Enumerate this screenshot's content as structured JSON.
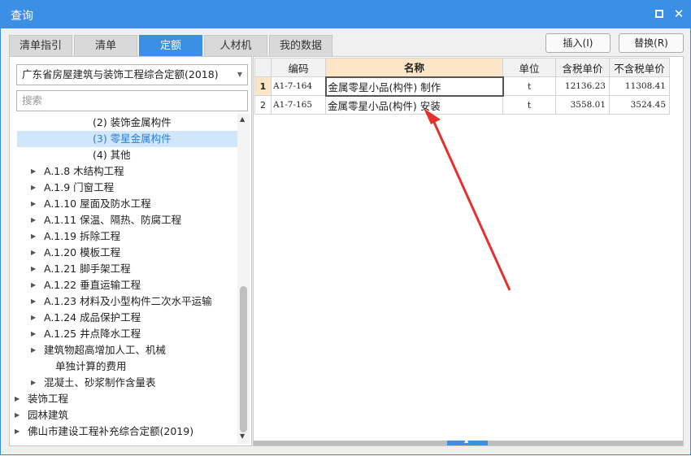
{
  "window": {
    "title": "查询",
    "maximize_icon": "maximize-icon",
    "close_icon": "close-icon",
    "close_glyph": "✕"
  },
  "tabs": [
    {
      "label": "清单指引"
    },
    {
      "label": "清单"
    },
    {
      "label": "定额",
      "active": true
    },
    {
      "label": "人材机"
    },
    {
      "label": "我的数据"
    }
  ],
  "actions": {
    "insert": "插入(I)",
    "replace": "替换(R)"
  },
  "left": {
    "selected_library": "广东省房屋建筑与装饰工程综合定额(2018)",
    "search_placeholder": "搜索",
    "tree": [
      {
        "label": "(2) 装饰金属构件",
        "arrow": ""
      },
      {
        "label": "(3) 零星金属构件",
        "arrow": "",
        "selected": true
      },
      {
        "label": "(4) 其他",
        "arrow": ""
      },
      {
        "label": "A.1.8 木结构工程",
        "arrow": "▶"
      },
      {
        "label": "A.1.9 门窗工程",
        "arrow": "▶"
      },
      {
        "label": "A.1.10 屋面及防水工程",
        "arrow": "▶"
      },
      {
        "label": "A.1.11 保温、隔热、防腐工程",
        "arrow": "▶"
      },
      {
        "label": "A.1.19 拆除工程",
        "arrow": "▶"
      },
      {
        "label": "A.1.20 模板工程",
        "arrow": "▶"
      },
      {
        "label": "A.1.21 脚手架工程",
        "arrow": "▶"
      },
      {
        "label": "A.1.22 垂直运输工程",
        "arrow": "▶"
      },
      {
        "label": "A.1.23 材料及小型构件二次水平运输",
        "arrow": "▶"
      },
      {
        "label": "A.1.24 成品保护工程",
        "arrow": "▶"
      },
      {
        "label": "A.1.25 井点降水工程",
        "arrow": "▶"
      },
      {
        "label": "建筑物超高增加人工、机械",
        "arrow": "▶"
      },
      {
        "label": "单独计算的费用",
        "arrow": ""
      },
      {
        "label": "混凝土、砂浆制作含量表",
        "arrow": "▶"
      },
      {
        "label": "装饰工程",
        "arrow": "▶"
      },
      {
        "label": "园林建筑",
        "arrow": "▶"
      },
      {
        "label": "佛山市建设工程补充综合定额(2019)",
        "arrow": "▶"
      }
    ],
    "scroll_up": "▲",
    "scroll_down": "▼"
  },
  "grid": {
    "headers": {
      "code": "编码",
      "name": "名称",
      "unit": "单位",
      "price_tax": "含税单价",
      "price_notax": "不含税单价"
    },
    "rows": [
      {
        "num": "1",
        "code": "A1-7-164",
        "name": "金属零星小品(构件) 制作",
        "unit": "t",
        "price_tax": "12136.23",
        "price_notax": "11308.41"
      },
      {
        "num": "2",
        "code": "A1-7-165",
        "name": "金属零星小品(构件) 安装",
        "unit": "t",
        "price_tax": "3558.01",
        "price_notax": "3524.45"
      }
    ]
  },
  "colors": {
    "accent": "#3b8fe5",
    "highlight": "#fde6c8",
    "annotation_arrow": "#e8302a"
  }
}
